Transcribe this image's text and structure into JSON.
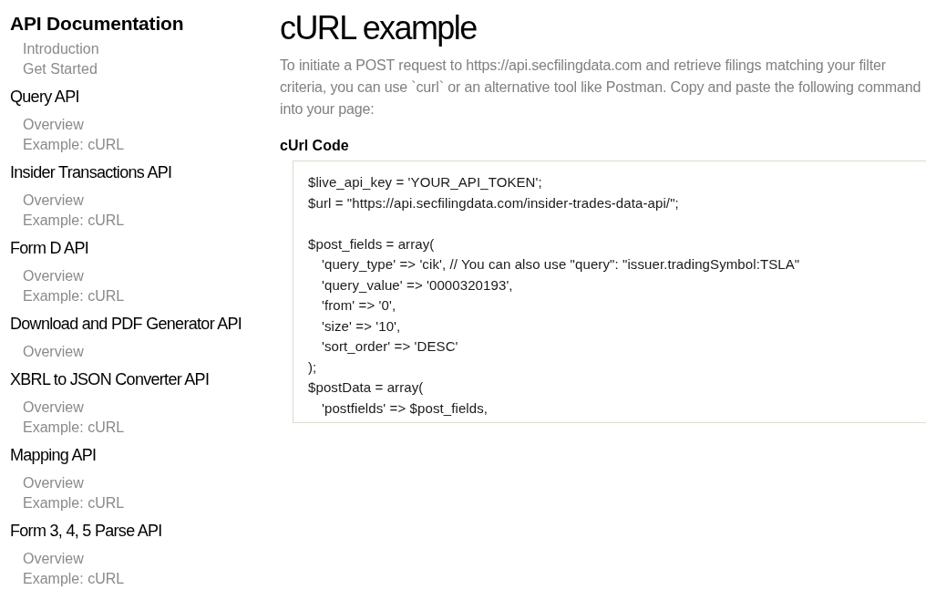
{
  "sidebar": {
    "title": "API Documentation",
    "intro_links": [
      "Introduction",
      "Get Started"
    ],
    "sections": [
      {
        "heading": "Query API",
        "links": [
          "Overview",
          "Example: cURL"
        ]
      },
      {
        "heading": "Insider Transactions API",
        "links": [
          "Overview",
          "Example: cURL"
        ]
      },
      {
        "heading": "Form D API",
        "links": [
          "Overview",
          "Example: cURL"
        ]
      },
      {
        "heading": "Download and PDF Generator API",
        "links": [
          "Overview"
        ]
      },
      {
        "heading": "XBRL to JSON Converter API",
        "links": [
          "Overview",
          "Example: cURL"
        ]
      },
      {
        "heading": "Mapping API",
        "links": [
          "Overview",
          "Example: cURL"
        ]
      },
      {
        "heading": "Form 3, 4, 5 Parse API",
        "links": [
          "Overview",
          "Example: cURL"
        ]
      }
    ]
  },
  "main": {
    "title": "cURL example",
    "intro": "To initiate a POST request to https://api.secfilingdata.com and retrieve filings matching your filter criteria, you can use `curl` or an alternative tool like Postman. Copy and paste the following command into your page:",
    "code_heading": "cUrl Code",
    "code_blocks": [
      [
        {
          "text": "$live_api_key = 'YOUR_API_TOKEN';",
          "indented": false
        },
        {
          "text": "$url = \"https://api.secfilingdata.com/insider-trades-data-api/\";",
          "indented": false
        }
      ],
      [
        {
          "text": "$post_fields = array(",
          "indented": false
        },
        {
          "text": "'query_type' => 'cik', // You can also use \"query\": \"issuer.tradingSymbol:TSLA\"",
          "indented": true
        },
        {
          "text": "'query_value' => '0000320193',",
          "indented": true
        },
        {
          "text": "'from' => '0',",
          "indented": true
        },
        {
          "text": "'size' => '10',",
          "indented": true
        },
        {
          "text": "'sort_order' => 'DESC'",
          "indented": true
        },
        {
          "text": ");",
          "indented": false
        },
        {
          "text": "$postData = array(",
          "indented": false
        },
        {
          "text": "'postfields' => $post_fields,",
          "indented": true
        }
      ]
    ]
  }
}
